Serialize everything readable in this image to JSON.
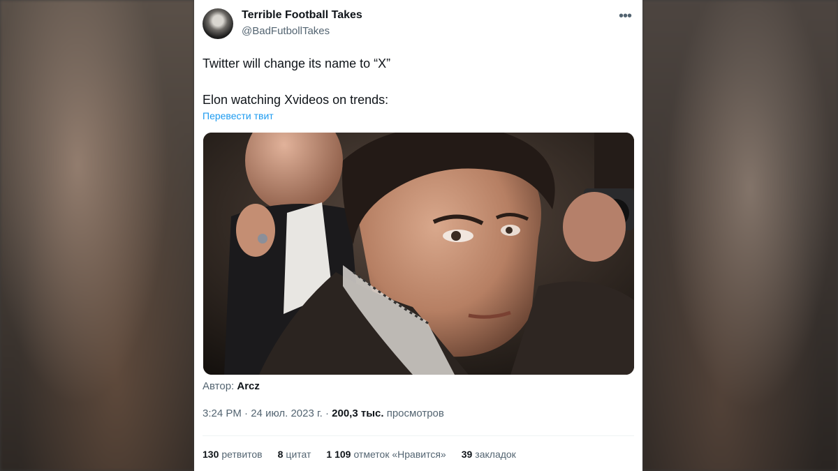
{
  "tweet": {
    "author_name": "Terrible Football Takes",
    "author_handle": "@BadFutbollTakes",
    "more_icon": "•••",
    "text_line1": "Twitter will change its name to “X”",
    "text_line2": "Elon watching Xvideos on trends:",
    "translate_label": "Перевести твит",
    "media_credit_prefix": "Автор:",
    "media_credit_name": "Arcz",
    "time": "3:24 PM",
    "date": "24 июл. 2023 г.",
    "views_count": "200,3 тыс.",
    "views_label": "просмотров"
  },
  "stats": {
    "retweets_count": "130",
    "retweets_label": "ретвитов",
    "quotes_count": "8",
    "quotes_label": "цитат",
    "likes_count": "1 109",
    "likes_label": "отметок «Нравится»",
    "bookmarks_count": "39",
    "bookmarks_label": "закладок"
  },
  "colors": {
    "link_blue": "#1d9bf0",
    "secondary_text": "#536471",
    "primary_text": "#0f1419"
  }
}
